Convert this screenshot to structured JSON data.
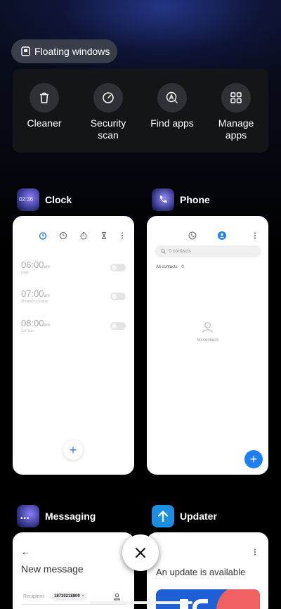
{
  "floating_windows": {
    "label": "Floating windows",
    "icon": "floating-window-icon"
  },
  "tools": [
    {
      "label": "Cleaner",
      "icon": "trash-icon"
    },
    {
      "label": "Security\nscan",
      "icon": "security-scan-icon"
    },
    {
      "label": "Find apps",
      "icon": "find-apps-icon"
    },
    {
      "label": "Manage\napps",
      "icon": "grid-icon"
    }
  ],
  "apps": {
    "clock": {
      "name": "Clock",
      "icon_time": "02:36",
      "alarms": [
        {
          "time": "06:00",
          "ampm": "am",
          "repeat": "Daily"
        },
        {
          "time": "07:00",
          "ampm": "am",
          "repeat": "Monday to Friday"
        },
        {
          "time": "08:00",
          "ampm": "am",
          "repeat": "Sat Sun"
        }
      ],
      "fab": "+"
    },
    "phone": {
      "name": "Phone",
      "search_placeholder": "0 contacts",
      "filter": "All contacts",
      "filter_count": "0",
      "empty_text": "No contacts",
      "fab": "+"
    },
    "messaging": {
      "name": "Messaging",
      "back": "←",
      "title": "New message",
      "recipient_label": "Recipient:",
      "recipient_chip": "18730218809"
    },
    "updater": {
      "name": "Updater",
      "title": "An update is available"
    }
  },
  "colors": {
    "accent": "#1f7ef2",
    "card": "#ffffff",
    "tool_tile": "#141518"
  }
}
